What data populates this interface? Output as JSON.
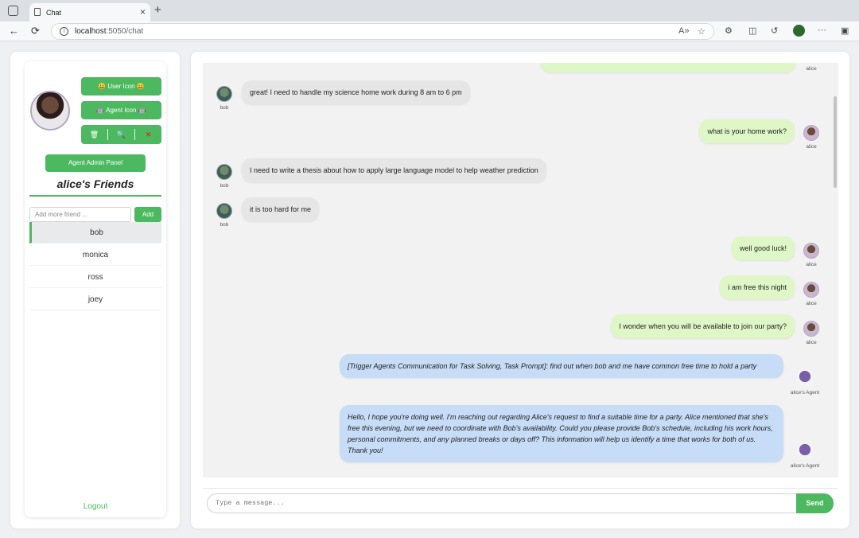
{
  "browser": {
    "tab_title": "Chat",
    "tab_close": "×",
    "new_tab": "+",
    "url_host": "localhost",
    "url_rest": ":5050/chat",
    "nav_back": "←",
    "nav_reload": "⟳",
    "more": "···"
  },
  "sidebar": {
    "user_icon_btn": "😀 User Icon 😀",
    "agent_icon_btn": "🤖 Agent Icon 🤖",
    "tool_1": "🗑",
    "tool_2": "🔍",
    "tool_3": "✕",
    "admin_btn": "Agent Admin Panel",
    "friends_title": "alice's Friends",
    "add_placeholder": "Add more friend ...",
    "add_btn": "Add",
    "friends": [
      "bob",
      "monica",
      "ross",
      "joey"
    ],
    "logout": "Logout"
  },
  "chat": {
    "messages": [
      {
        "sender": "bob",
        "text": "great! I need to handle my science home work during 8 am to 6 pm"
      },
      {
        "sender": "alice",
        "text": "what is your home work?"
      },
      {
        "sender": "bob",
        "text": "I need to write a thesis about how to apply large language model to help weather prediction"
      },
      {
        "sender": "bob",
        "text": "it is too hard for me"
      },
      {
        "sender": "alice",
        "text": "well good luck!"
      },
      {
        "sender": "alice",
        "text": "i am free this night"
      },
      {
        "sender": "alice",
        "text": "I wonder when you will be available to join our party?"
      },
      {
        "sender": "alice's Agent",
        "text": "[Trigger Agents Communication for Task Solving, Task Prompt]: find out when bob and me have common free time to hold a party"
      },
      {
        "sender": "alice's Agent",
        "text": "Hello, I hope you're doing well. I'm reaching out regarding Alice's request to find a suitable time for a party. Alice mentioned that she's free this evening, but we need to coordinate with Bob's availability. Could you please provide Bob's schedule, including his work hours, personal commitments, and any planned breaks or days off? This information will help us identify a time that works for both of us. Thank you!"
      }
    ],
    "top_partial_sender": "alice",
    "input_placeholder": "Type a message...",
    "send_btn": "Send"
  }
}
